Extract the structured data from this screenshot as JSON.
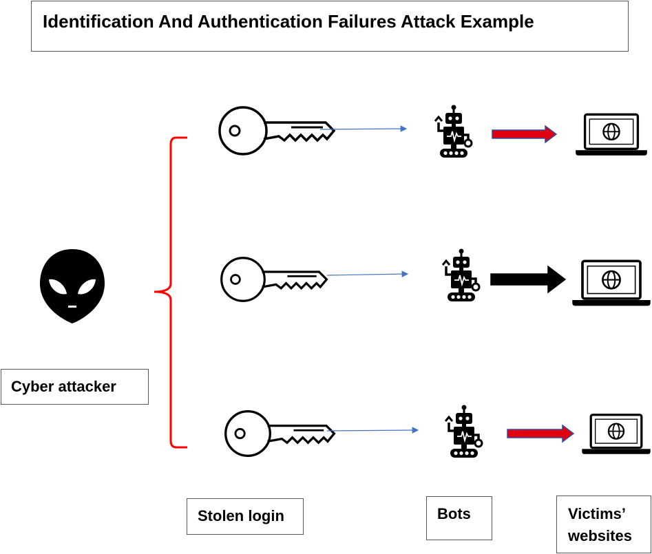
{
  "title": "Identification And Authentication Failures Attack Example",
  "labels": {
    "attacker": "Cyber attacker",
    "stolen_login": "Stolen login",
    "bots": "Bots",
    "victims_line1": "Victims’",
    "victims_line2": "websites"
  },
  "icons": {
    "attacker": "alien-icon",
    "credential": "key-icon",
    "bot": "robot-icon",
    "target": "laptop-globe-icon"
  },
  "rows": [
    {
      "flow_arrow_color": "#e0000f",
      "flow_arrow_border": "#2f4f9f"
    },
    {
      "flow_arrow_color": "#000000",
      "flow_arrow_border": "#000000"
    },
    {
      "flow_arrow_color": "#e0000f",
      "flow_arrow_border": "#2f4f9f"
    }
  ],
  "colors": {
    "brace": "#ff0000",
    "connector": "#4472c4",
    "icon": "#000000"
  }
}
